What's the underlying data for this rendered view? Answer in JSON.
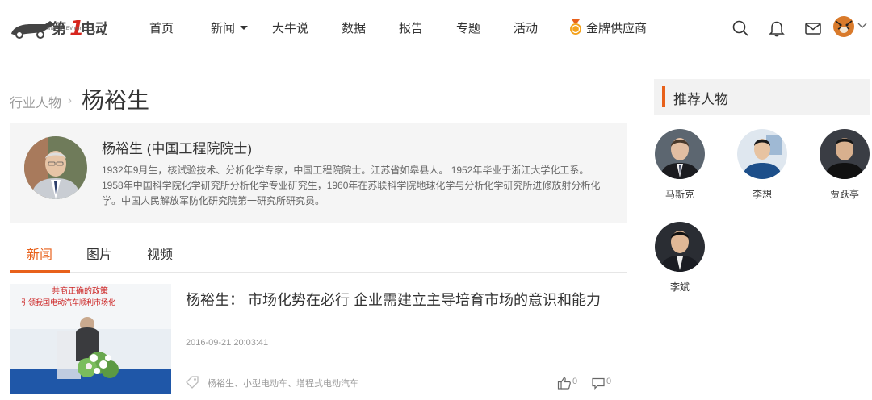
{
  "header": {
    "logo_text": "第1电动",
    "logo_url": "www.D1EV.com",
    "nav": [
      "首页",
      "新闻",
      "大牛说",
      "数据",
      "报告",
      "专题",
      "活动",
      "金牌供应商"
    ],
    "icons": [
      "search-icon",
      "bell-icon",
      "mail-icon",
      "user-avatar",
      "chevron-down-icon"
    ]
  },
  "breadcrumb": {
    "parent": "行业人物",
    "separator": "›",
    "current": "杨裕生"
  },
  "profile": {
    "name": "杨裕生 (中国工程院院士)",
    "bio": "1932年9月生，核试验技术、分析化学专家，中国工程院院士。江苏省如皋县人。 1952年毕业于浙江大学化工系。1958年中国科学院化学研究所分析化学专业研究生，1960年在苏联科学院地球化学与分析化学研究所进修放射分析化学。中国人民解放军防化研究院第一研究所研究员。"
  },
  "tabs": [
    "新闻",
    "图片",
    "视频"
  ],
  "article": {
    "thumb_caption_1": "共商正确的政策",
    "thumb_caption_2": "引领我国电动汽车顺利市场化",
    "title": "杨裕生：  市场化势在必行 企业需建立主导培育市场的意识和能力",
    "time": "2016-09-21 20:03:41",
    "tags": "杨裕生、小型电动车、增程式电动汽车",
    "likes": "0",
    "comments": "0"
  },
  "sidebar": {
    "title": "推荐人物",
    "people": [
      "马斯克",
      "李想",
      "贾跃亭",
      "李斌"
    ]
  },
  "colors": {
    "accent": "#e8611b",
    "logo_red": "#d7261e"
  }
}
